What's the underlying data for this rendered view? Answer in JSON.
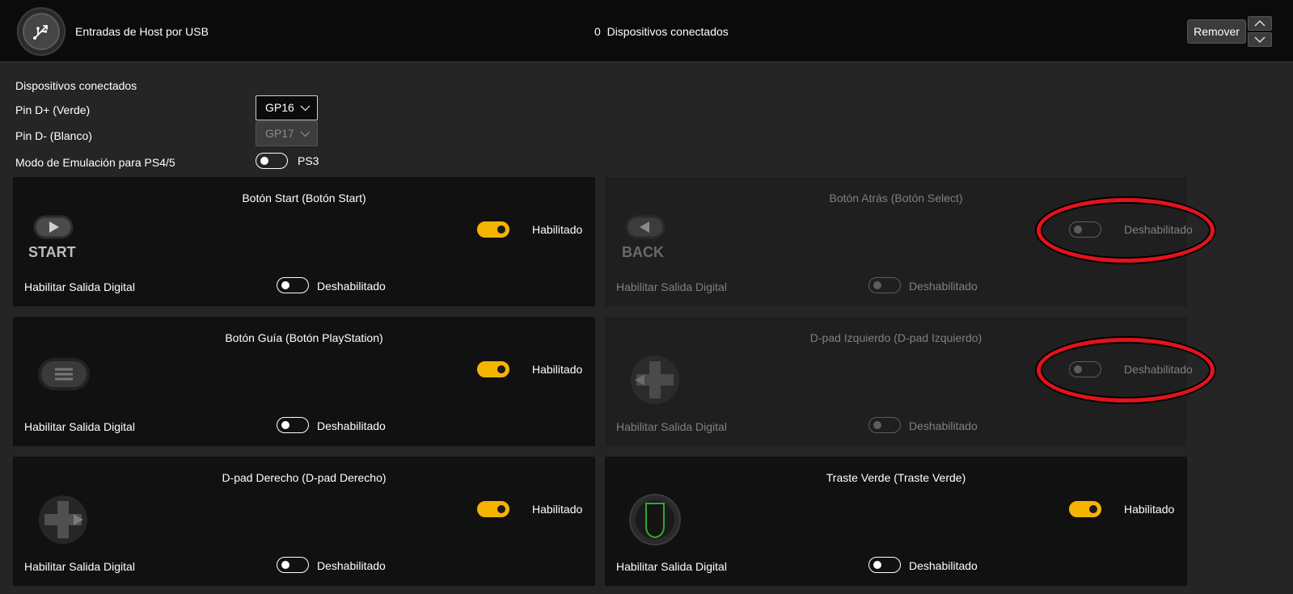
{
  "header": {
    "title": "Entradas de Host por USB",
    "device_count": "0",
    "status": "Dispositivos conectados",
    "remove_label": "Remover"
  },
  "config": {
    "section_title": "Dispositivos conectados",
    "pin_dplus_label": "Pin D+ (Verde)",
    "pin_dplus_value": "GP16",
    "pin_dminus_label": "Pin D- (Blanco)",
    "pin_dminus_value": "GP17",
    "emulation_label": "Modo de Emulación para PS4/5",
    "emulation_value": "PS3"
  },
  "cards": [
    {
      "title": "Botón Start (Botón Start)",
      "icon": "start-button-icon",
      "icon_text": "START",
      "enabled": true,
      "state": "Habilitado",
      "digital_label": "Habilitar Salida Digital",
      "digital_state": "Deshabilitado"
    },
    {
      "title": "Botón Atrás (Botón Select)",
      "icon": "back-button-icon",
      "icon_text": "BACK",
      "enabled": false,
      "state": "Deshabilitado",
      "digital_label": "Habilitar Salida Digital",
      "digital_state": "Deshabilitado"
    },
    {
      "title": "Botón Guía (Botón PlayStation)",
      "icon": "guide-button-icon",
      "enabled": true,
      "state": "Habilitado",
      "digital_label": "Habilitar Salida Digital",
      "digital_state": "Deshabilitado"
    },
    {
      "title": "D-pad Izquierdo (D-pad Izquierdo)",
      "icon": "dpad-left-icon",
      "enabled": false,
      "state": "Deshabilitado",
      "digital_label": "Habilitar Salida Digital",
      "digital_state": "Deshabilitado"
    },
    {
      "title": "D-pad Derecho (D-pad Derecho)",
      "icon": "dpad-right-icon",
      "enabled": true,
      "state": "Habilitado",
      "digital_label": "Habilitar Salida Digital",
      "digital_state": "Deshabilitado"
    },
    {
      "title": "Traste Verde (Traste Verde)",
      "icon": "green-fret-icon",
      "enabled": true,
      "state": "Habilitado",
      "digital_label": "Habilitar Salida Digital",
      "digital_state": "Deshabilitado"
    }
  ],
  "colors": {
    "accent": "#f5b400",
    "highlight": "#e2131b",
    "fret_green": "#2fa83a"
  }
}
